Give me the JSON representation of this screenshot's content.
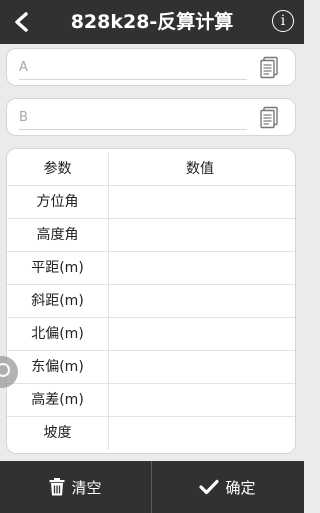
{
  "header": {
    "title": "828k28-反算计算",
    "back_icon": "chevron-left-icon",
    "info_icon": "info-icon",
    "info_glyph": "i"
  },
  "inputs": {
    "a": {
      "placeholder": "A",
      "value": "",
      "picker_icon": "document-icon"
    },
    "b": {
      "placeholder": "B",
      "value": "",
      "picker_icon": "document-icon"
    }
  },
  "table": {
    "header": {
      "param": "参数",
      "value": "数值"
    },
    "rows": [
      {
        "param": "方位角",
        "value": ""
      },
      {
        "param": "高度角",
        "value": ""
      },
      {
        "param": "平距(m)",
        "value": ""
      },
      {
        "param": "斜距(m)",
        "value": ""
      },
      {
        "param": "北偏(m)",
        "value": ""
      },
      {
        "param": "东偏(m)",
        "value": ""
      },
      {
        "param": "高差(m)",
        "value": ""
      },
      {
        "param": "坡度",
        "value": ""
      }
    ]
  },
  "footer": {
    "clear_label": "清空",
    "clear_icon": "trash-icon",
    "confirm_label": "确定",
    "confirm_icon": "checkmark-icon"
  },
  "colors": {
    "bar_background": "#2f3133",
    "page_background": "#ebebeb"
  }
}
